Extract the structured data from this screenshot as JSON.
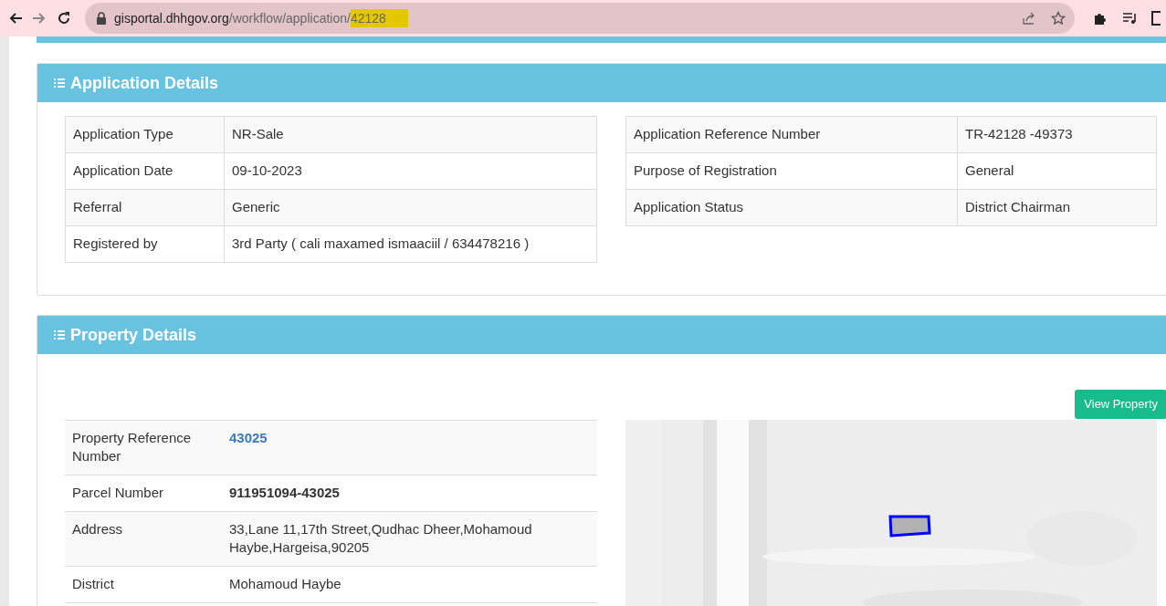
{
  "browser": {
    "url": {
      "host": "gisportal.dhhgov.org",
      "path": "/workflow/application/",
      "highlighted": "42128"
    }
  },
  "application_details": {
    "title": "Application Details",
    "left_rows": [
      {
        "label": "Application Type",
        "value": "NR-Sale"
      },
      {
        "label": "Application Date",
        "value": "09-10-2023"
      },
      {
        "label": "Referral",
        "value": "Generic"
      },
      {
        "label": "Registered by",
        "value": "3rd Party ( cali maxamed ismaaciil / 634478216 )"
      }
    ],
    "right_rows": [
      {
        "label": "Application Reference Number",
        "value": "TR-42128 -49373"
      },
      {
        "label": "Purpose of Registration",
        "value": "General"
      },
      {
        "label": "Application Status",
        "value": "District Chairman"
      }
    ]
  },
  "property_details": {
    "title": "Property Details",
    "button": "View Property",
    "rows": [
      {
        "label": "Property Reference Number",
        "value": "43025",
        "kind": "link"
      },
      {
        "label": "Parcel Number",
        "value": "911951094-43025",
        "kind": "bold"
      },
      {
        "label": "Address",
        "value": "33,Lane 11,17th Street,Qudhac Dheer,Mohamoud Haybe,Hargeisa,90205",
        "kind": "plain"
      },
      {
        "label": "District",
        "value": "Mohamoud Haybe",
        "kind": "plain"
      }
    ]
  }
}
